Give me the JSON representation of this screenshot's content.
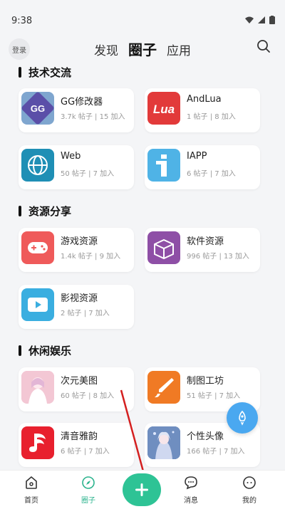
{
  "status": {
    "time": "9:38"
  },
  "header": {
    "login_label": "登录",
    "tabs": [
      {
        "label": "发现"
      },
      {
        "label": "圈子"
      },
      {
        "label": "应用"
      }
    ]
  },
  "sections": [
    {
      "title": "技术交流",
      "cards": [
        {
          "name": "GG修改器",
          "stats": "3.7k 帖子 | 15 加入",
          "icon": "gg-icon",
          "color": "#5b4fa8"
        },
        {
          "name": "AndLua",
          "stats": "1 帖子 | 8 加入",
          "icon": "lua-icon",
          "color": "#e23a3a"
        },
        {
          "name": "Web",
          "stats": "50 帖子 | 7 加入",
          "icon": "globe-icon",
          "color": "#1f8fb5"
        },
        {
          "name": "IAPP",
          "stats": "6 帖子 | 7 加入",
          "icon": "info-i-icon",
          "color": "#4fb3e6"
        }
      ]
    },
    {
      "title": "资源分享",
      "cards": [
        {
          "name": "游戏资源",
          "stats": "1.4k 帖子 | 9 加入",
          "icon": "gamepad-icon",
          "color": "#ef5a5a"
        },
        {
          "name": "软件资源",
          "stats": "996 帖子 | 13 加入",
          "icon": "box-icon",
          "color": "#8e4fa6"
        },
        {
          "name": "影视资源",
          "stats": "2 帖子 | 7 加入",
          "icon": "play-icon",
          "color": "#3aaee0"
        }
      ]
    },
    {
      "title": "休闲娱乐",
      "cards": [
        {
          "name": "次元美图",
          "stats": "60 帖子 | 8 加入",
          "icon": "anime-girl-icon",
          "color": "#f3b8c8"
        },
        {
          "name": "制图工坊",
          "stats": "51 帖子 | 7 加入",
          "icon": "brush-icon",
          "color": "#f07a24"
        },
        {
          "name": "清音雅韵",
          "stats": "6 帖子 | 7 加入",
          "icon": "music-icon",
          "color": "#e8202e"
        },
        {
          "name": "个性头像",
          "stats": "166 帖子 | 7 加入",
          "icon": "avatar-portrait-icon",
          "color": "#4a6fa0"
        }
      ]
    }
  ],
  "bottom_nav": [
    {
      "label": "首页",
      "icon": "home-icon"
    },
    {
      "label": "圈子",
      "icon": "compass-icon"
    },
    {
      "label": "",
      "icon": "plus-icon"
    },
    {
      "label": "消息",
      "icon": "message-icon"
    },
    {
      "label": "我的",
      "icon": "profile-icon"
    }
  ],
  "colors": {
    "accent": "#2ec395",
    "fab": "#4aa8f0"
  }
}
